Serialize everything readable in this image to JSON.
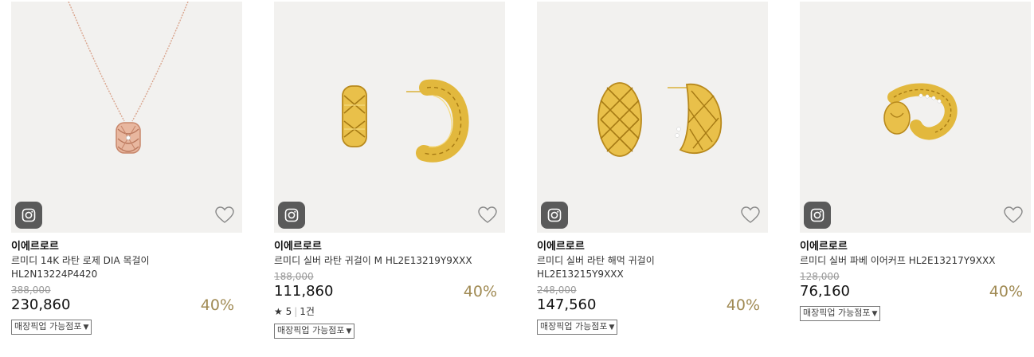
{
  "products": [
    {
      "brand": "이에르로르",
      "name_line1": "르미디 14K 라탄 로제 DIA 목걸이",
      "name_line2": "HL2N13224P4420",
      "original_price": "388,000",
      "price": "230,860",
      "discount": "40%",
      "pickup_label": "매장픽업 가능점포",
      "image": "rose-gold-necklace"
    },
    {
      "brand": "이에르로르",
      "name_line1": "르미디 실버 라탄 귀걸이 M HL2E13219Y9XXX",
      "original_price": "188,000",
      "price": "111,860",
      "discount": "40%",
      "rating_star": "★",
      "rating": "5",
      "review_count": "1건",
      "pickup_label": "매장픽업 가능점포",
      "image": "gold-rattan-hoop-earrings"
    },
    {
      "brand": "이에르로르",
      "name_line1": "르미디 실버 라탄 해먹 귀걸이",
      "name_line2": "HL2E13215Y9XXX",
      "original_price": "248,000",
      "price": "147,560",
      "discount": "40%",
      "pickup_label": "매장픽업 가능점포",
      "image": "gold-lattice-earrings"
    },
    {
      "brand": "이에르로르",
      "name_line1": "르미디 실버 파베 이어커프 HL2E13217Y9XXX",
      "original_price": "128,000",
      "price": "76,160",
      "discount": "40%",
      "pickup_label": "매장픽업 가능점포",
      "image": "gold-pave-ear-cuff"
    }
  ],
  "icons": {
    "instagram": "instagram-icon",
    "wishlist": "heart-icon",
    "dropdown": "caret-down-icon"
  },
  "colors": {
    "discount": "#a08a53",
    "thumb_bg": "#f2f1ef",
    "insta_bg": "#5a5a5a"
  }
}
